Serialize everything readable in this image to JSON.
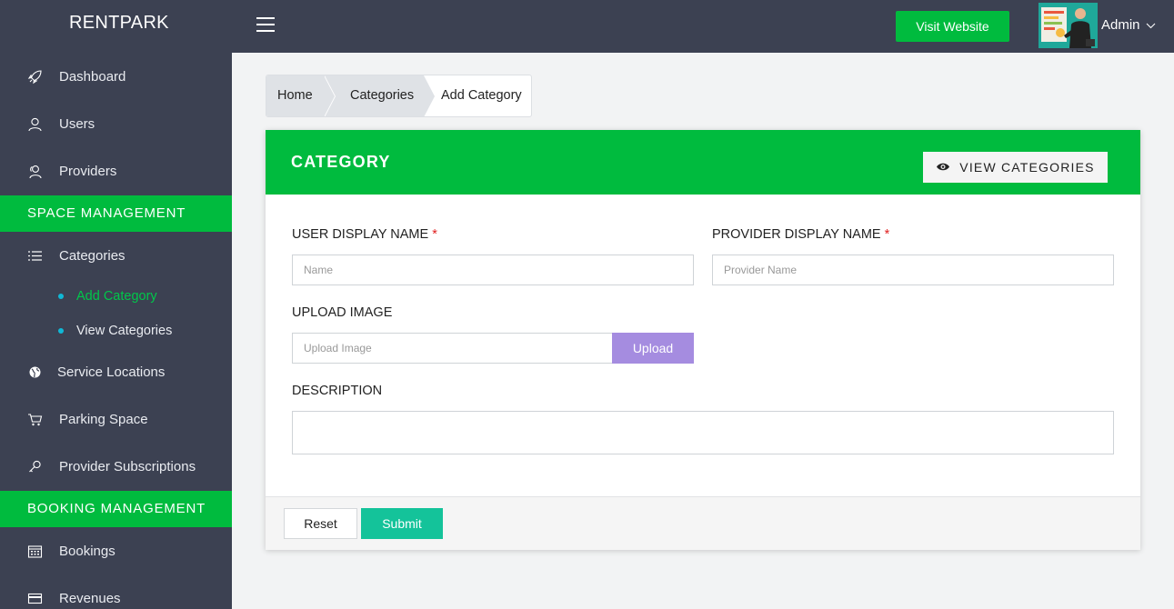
{
  "brand": "RENTPARK",
  "topbar": {
    "visit_website": "Visit Website",
    "admin_label": "Admin"
  },
  "sidebar": {
    "items": [
      {
        "label": "Dashboard",
        "icon": "rocket-icon"
      },
      {
        "label": "Users",
        "icon": "user-icon"
      },
      {
        "label": "Providers",
        "icon": "users-icon"
      }
    ],
    "section_space": "SPACE MANAGEMENT",
    "categories": {
      "label": "Categories",
      "icon": "list-icon"
    },
    "sub_items": [
      {
        "label": "Add Category",
        "active": true
      },
      {
        "label": "View Categories",
        "active": false
      }
    ],
    "items2": [
      {
        "label": "Service Locations",
        "icon": "globe-icon"
      },
      {
        "label": "Parking Space",
        "icon": "cart-icon"
      },
      {
        "label": "Provider Subscriptions",
        "icon": "key-icon"
      }
    ],
    "section_booking": "BOOKING MANAGEMENT",
    "items3": [
      {
        "label": "Bookings",
        "icon": "calendar-icon"
      },
      {
        "label": "Revenues",
        "icon": "card-icon"
      }
    ]
  },
  "breadcrumb": [
    "Home",
    "Categories",
    "Add Category"
  ],
  "card": {
    "title": "CATEGORY",
    "view_button": "VIEW CATEGORIES"
  },
  "form": {
    "user_display_name_label": "USER DISPLAY NAME",
    "user_display_name_placeholder": "Name",
    "provider_display_name_label": "PROVIDER DISPLAY NAME",
    "provider_display_name_placeholder": "Provider Name",
    "required_mark": "*",
    "upload_image_label": "UPLOAD IMAGE",
    "upload_image_placeholder": "Upload Image",
    "upload_button": "Upload",
    "description_label": "DESCRIPTION",
    "reset_button": "Reset",
    "submit_button": "Submit"
  },
  "colors": {
    "sidebar_bg": "#3c4152",
    "accent_green": "#00bb3e",
    "submit_teal": "#14c39a",
    "upload_purple": "#a58ce0"
  }
}
